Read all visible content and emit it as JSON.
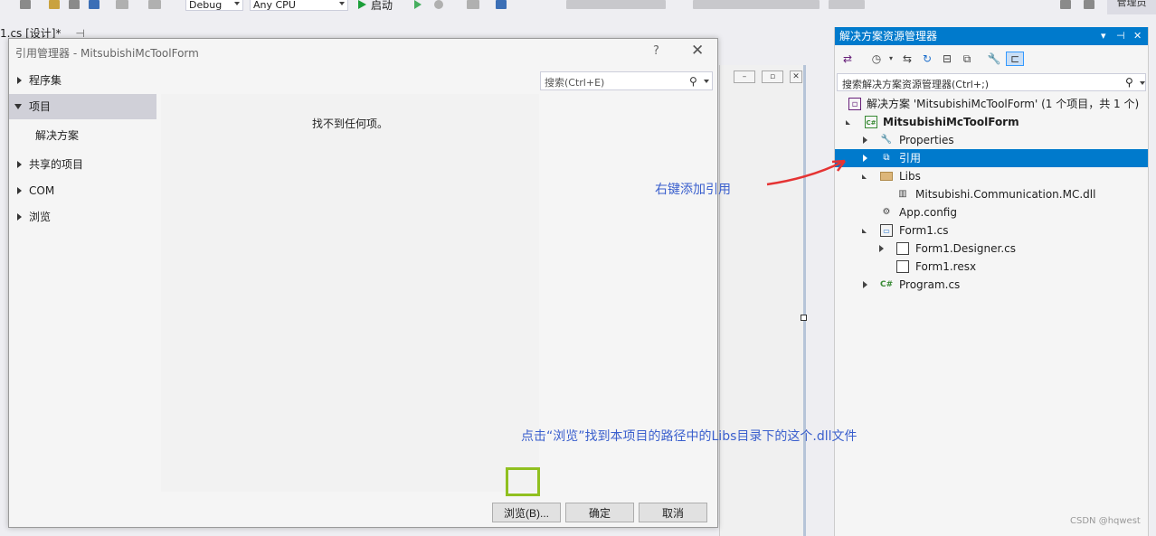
{
  "toolbar": {
    "config": "Debug",
    "platform": "Any CPU",
    "run_label": "启动",
    "admin_label": "管理员"
  },
  "doc_tab": {
    "title": "1.cs [设计]*",
    "pin": "⊣"
  },
  "dialog": {
    "title": "引用管理器 - MitsubishiMcToolForm",
    "help": "?",
    "close": "✕",
    "nav": [
      {
        "label": "程序集",
        "expanded": false
      },
      {
        "label": "项目",
        "expanded": true,
        "selected": true
      },
      {
        "label": "解决方案",
        "sub": true
      },
      {
        "label": "共享的项目",
        "expanded": false
      },
      {
        "label": "COM",
        "expanded": false
      },
      {
        "label": "浏览",
        "expanded": false
      }
    ],
    "search_placeholder": "搜索(Ctrl+E)",
    "empty_message": "找不到任何项。",
    "buttons": {
      "browse": "浏览(B)...",
      "ok": "确定",
      "cancel": "取消"
    }
  },
  "solution_explorer": {
    "title": "解决方案资源管理器",
    "title_controls": [
      "▾",
      "⊣",
      "✕"
    ],
    "search_placeholder": "搜索解决方案资源管理器(Ctrl+;)",
    "nodes": [
      {
        "label": "解决方案 'MitsubishiMcToolForm' (1 个项目，共 1 个)",
        "icon": "solution-icon",
        "level": 0
      },
      {
        "label": "MitsubishiMcToolForm",
        "icon": "csharp-project-icon",
        "level": 1,
        "bold": true,
        "state": "expanded"
      },
      {
        "label": "Properties",
        "icon": "wrench-icon",
        "level": 2,
        "state": "collapsed"
      },
      {
        "label": "引用",
        "icon": "references-icon",
        "level": 2,
        "state": "collapsed",
        "selected": true
      },
      {
        "label": "Libs",
        "icon": "folder-icon",
        "level": 2,
        "state": "expanded"
      },
      {
        "label": "Mitsubishi.Communication.MC.dll",
        "icon": "dll-icon",
        "level": 3
      },
      {
        "label": "App.config",
        "icon": "config-icon",
        "level": 2
      },
      {
        "label": "Form1.cs",
        "icon": "form-icon",
        "level": 2,
        "state": "expanded"
      },
      {
        "label": "Form1.Designer.cs",
        "icon": "file-icon",
        "level": 3,
        "state": "collapsed"
      },
      {
        "label": "Form1.resx",
        "icon": "file-icon",
        "level": 3
      },
      {
        "label": "Program.cs",
        "icon": "csharp-file-icon",
        "level": 2,
        "state": "collapsed"
      }
    ]
  },
  "annotations": {
    "right_click": "右键添加引用",
    "browse_hint": "点击“浏览”找到本项目的路径中的Libs目录下的这个.dll文件",
    "credit": "CSDN @hqwest"
  },
  "colors": {
    "accent": "#007acc",
    "annotation_text": "#3a5fcd",
    "arrow": "#e53333",
    "highlight_box": "#90c020"
  }
}
